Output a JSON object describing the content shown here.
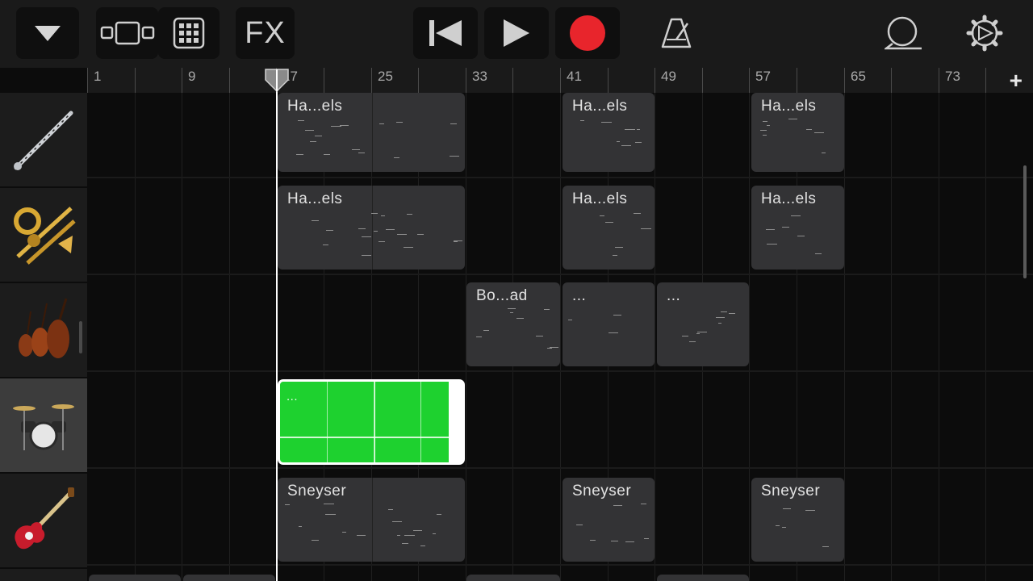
{
  "toolbar": {
    "fx_label": "FX",
    "colors": {
      "record": "#e8252c",
      "icon": "#cfcfcf"
    }
  },
  "ruler": {
    "labels": [
      "1",
      "9",
      "17",
      "25",
      "33",
      "41",
      "49",
      "57",
      "65",
      "73"
    ],
    "add_label": "+"
  },
  "tracks": [
    {
      "instrument": "oboe-icon"
    },
    {
      "instrument": "brass-icon"
    },
    {
      "instrument": "strings-icon"
    },
    {
      "instrument": "drum-kit-icon"
    },
    {
      "instrument": "bass-guitar-icon"
    }
  ],
  "regions": {
    "t0": [
      "Ha...els",
      "Ha...els",
      "Ha...els"
    ],
    "t1": [
      "Ha...els",
      "Ha...els",
      "Ha...els"
    ],
    "t2": [
      "Bo...ad",
      "...",
      "..."
    ],
    "t3": [
      "..."
    ],
    "t4": [
      "Sneyser",
      "Sneyser",
      "Sneyser"
    ]
  },
  "colors": {
    "region": "#333335",
    "selected_region": "#1ed12f",
    "playhead": "#ffffff"
  }
}
